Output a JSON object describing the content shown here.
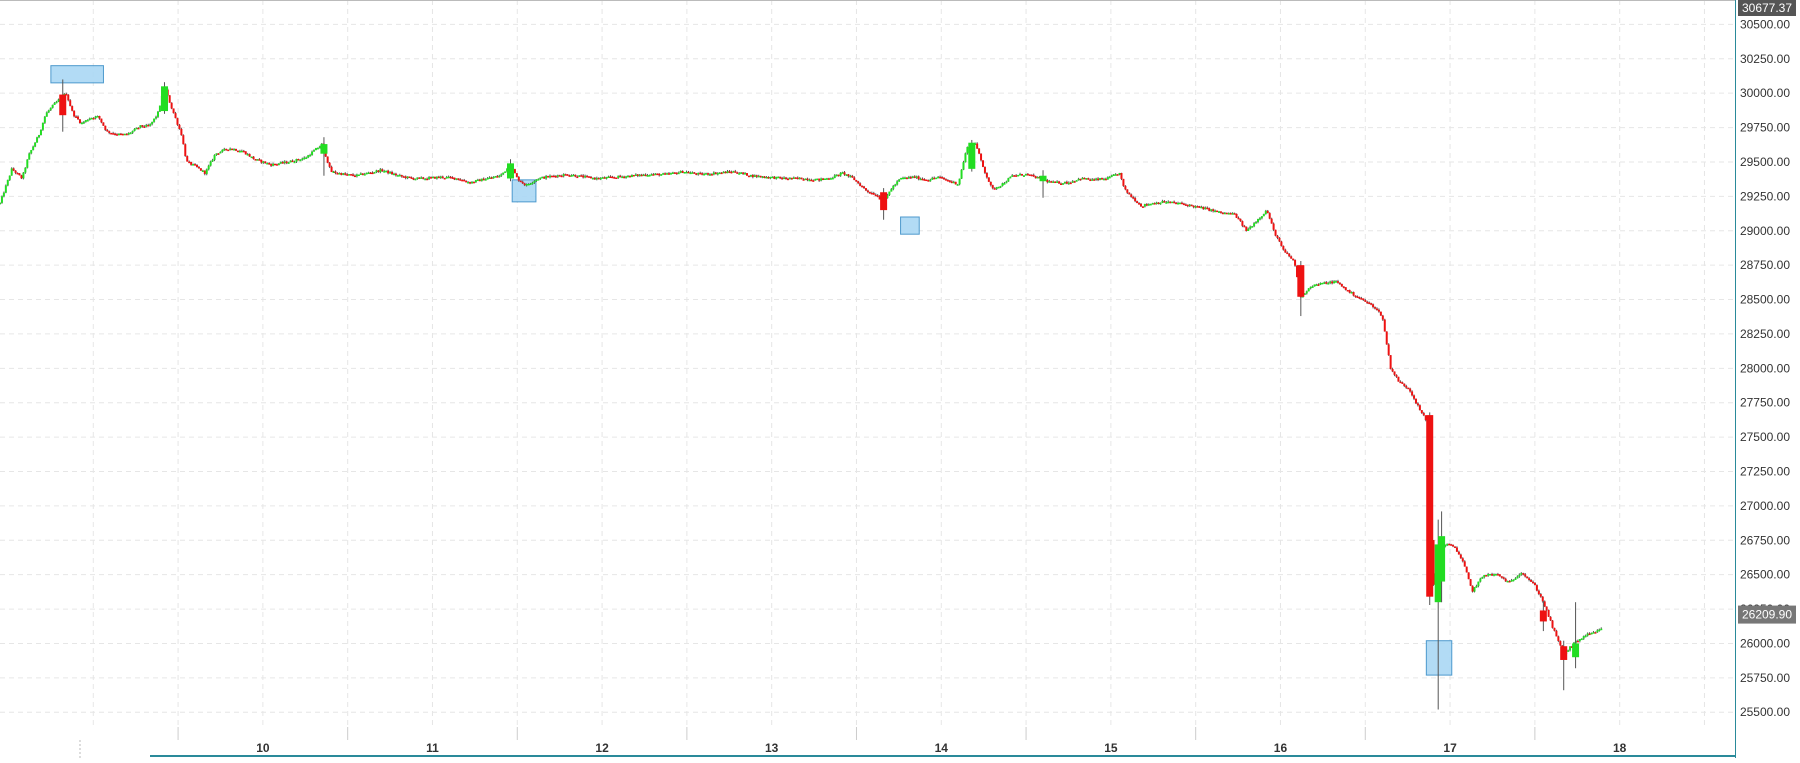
{
  "chart_data": {
    "type": "candlestick",
    "title": "",
    "xlabel": "",
    "ylabel": "",
    "ylim": [
      25400,
      30677.37
    ],
    "xlim": [
      8.45,
      18.68
    ],
    "grid": true,
    "y_ticks": [
      25500,
      25750,
      26000,
      26250,
      26500,
      26750,
      27000,
      27250,
      27500,
      27750,
      28000,
      28250,
      28500,
      28750,
      29000,
      29250,
      29500,
      29750,
      30000,
      30250,
      30500
    ],
    "y_tick_labels": [
      "25500.00",
      "25750.00",
      "26000.00",
      "26250.00",
      "26500.00",
      "26750.00",
      "27000.00",
      "27250.00",
      "27500.00",
      "27750.00",
      "28000.00",
      "28250.00",
      "28500.00",
      "28750.00",
      "29000.00",
      "29250.00",
      "29500.00",
      "29750.00",
      "30000.00",
      "30250.00",
      "30500.00"
    ],
    "x_ticks": [
      10,
      11,
      12,
      13,
      14,
      15,
      16,
      17,
      18
    ],
    "x_tick_labels": [
      "10",
      "11",
      "12",
      "13",
      "14",
      "15",
      "16",
      "17",
      "18"
    ],
    "top_price_label": "30677.37",
    "last_price_label": "26209.90",
    "last_price": 26209.9,
    "colors": {
      "up": "#22dd22",
      "down": "#ee1111",
      "wick": "#555555",
      "grid": "#e6e6e6",
      "marker_fill": "#aad8f5",
      "marker_stroke": "#3a8fc8",
      "axis_line": "#2a8a9a",
      "top_tag_bg": "#555555",
      "last_tag_bg": "#777777"
    },
    "path_points": [
      [
        8.45,
        29200
      ],
      [
        8.52,
        29450
      ],
      [
        8.58,
        29380
      ],
      [
        8.62,
        29550
      ],
      [
        8.68,
        29700
      ],
      [
        8.72,
        29850
      ],
      [
        8.77,
        29920
      ],
      [
        8.84,
        30000
      ],
      [
        8.88,
        29850
      ],
      [
        8.93,
        29780
      ],
      [
        8.98,
        29820
      ],
      [
        9.03,
        29830
      ],
      [
        9.08,
        29720
      ],
      [
        9.15,
        29700
      ],
      [
        9.2,
        29700
      ],
      [
        9.28,
        29760
      ],
      [
        9.33,
        29760
      ],
      [
        9.38,
        29850
      ],
      [
        9.42,
        30050
      ],
      [
        9.46,
        29900
      ],
      [
        9.52,
        29700
      ],
      [
        9.55,
        29500
      ],
      [
        9.6,
        29470
      ],
      [
        9.66,
        29420
      ],
      [
        9.72,
        29560
      ],
      [
        9.8,
        29600
      ],
      [
        9.88,
        29580
      ],
      [
        9.95,
        29520
      ],
      [
        10.05,
        29480
      ],
      [
        10.15,
        29500
      ],
      [
        10.25,
        29530
      ],
      [
        10.35,
        29630
      ],
      [
        10.4,
        29430
      ],
      [
        10.48,
        29410
      ],
      [
        10.55,
        29400
      ],
      [
        10.62,
        29420
      ],
      [
        10.7,
        29440
      ],
      [
        10.8,
        29400
      ],
      [
        10.88,
        29380
      ],
      [
        10.95,
        29380
      ],
      [
        11.05,
        29390
      ],
      [
        11.15,
        29380
      ],
      [
        11.22,
        29350
      ],
      [
        11.32,
        29380
      ],
      [
        11.4,
        29400
      ],
      [
        11.46,
        29480
      ],
      [
        11.5,
        29380
      ],
      [
        11.55,
        29330
      ],
      [
        11.62,
        29380
      ],
      [
        11.72,
        29400
      ],
      [
        11.8,
        29410
      ],
      [
        11.9,
        29390
      ],
      [
        11.97,
        29380
      ],
      [
        12.08,
        29390
      ],
      [
        12.18,
        29400
      ],
      [
        12.28,
        29410
      ],
      [
        12.38,
        29410
      ],
      [
        12.48,
        29430
      ],
      [
        12.58,
        29410
      ],
      [
        12.68,
        29420
      ],
      [
        12.78,
        29430
      ],
      [
        12.88,
        29400
      ],
      [
        12.98,
        29390
      ],
      [
        13.08,
        29380
      ],
      [
        13.18,
        29380
      ],
      [
        13.28,
        29370
      ],
      [
        13.36,
        29390
      ],
      [
        13.42,
        29420
      ],
      [
        13.48,
        29380
      ],
      [
        13.56,
        29290
      ],
      [
        13.62,
        29260
      ],
      [
        13.66,
        29200
      ],
      [
        13.7,
        29300
      ],
      [
        13.76,
        29380
      ],
      [
        13.84,
        29390
      ],
      [
        13.92,
        29370
      ],
      [
        13.98,
        29390
      ],
      [
        14.05,
        29360
      ],
      [
        14.1,
        29340
      ],
      [
        14.15,
        29600
      ],
      [
        14.2,
        29640
      ],
      [
        14.25,
        29450
      ],
      [
        14.3,
        29300
      ],
      [
        14.36,
        29340
      ],
      [
        14.42,
        29400
      ],
      [
        14.5,
        29410
      ],
      [
        14.58,
        29380
      ],
      [
        14.65,
        29350
      ],
      [
        14.75,
        29350
      ],
      [
        14.82,
        29380
      ],
      [
        14.9,
        29370
      ],
      [
        14.98,
        29380
      ],
      [
        15.05,
        29420
      ],
      [
        15.08,
        29300
      ],
      [
        15.12,
        29250
      ],
      [
        15.18,
        29180
      ],
      [
        15.24,
        29200
      ],
      [
        15.32,
        29210
      ],
      [
        15.4,
        29200
      ],
      [
        15.48,
        29180
      ],
      [
        15.56,
        29160
      ],
      [
        15.65,
        29130
      ],
      [
        15.73,
        29120
      ],
      [
        15.8,
        29000
      ],
      [
        15.88,
        29100
      ],
      [
        15.92,
        29150
      ],
      [
        15.96,
        29000
      ],
      [
        16.02,
        28850
      ],
      [
        16.08,
        28780
      ],
      [
        16.12,
        28520
      ],
      [
        16.18,
        28600
      ],
      [
        16.26,
        28620
      ],
      [
        16.33,
        28630
      ],
      [
        16.4,
        28560
      ],
      [
        16.48,
        28500
      ],
      [
        16.55,
        28450
      ],
      [
        16.6,
        28380
      ],
      [
        16.65,
        28000
      ],
      [
        16.7,
        27900
      ],
      [
        16.76,
        27850
      ],
      [
        16.82,
        27700
      ],
      [
        16.87,
        27600
      ],
      [
        16.9,
        26400
      ],
      [
        16.94,
        26700
      ],
      [
        16.98,
        26720
      ],
      [
        17.03,
        26700
      ],
      [
        17.08,
        26580
      ],
      [
        17.13,
        26380
      ],
      [
        17.2,
        26500
      ],
      [
        17.28,
        26500
      ],
      [
        17.35,
        26440
      ],
      [
        17.42,
        26520
      ],
      [
        17.5,
        26420
      ],
      [
        17.55,
        26300
      ],
      [
        17.61,
        26100
      ],
      [
        17.67,
        25920
      ],
      [
        17.73,
        26000
      ],
      [
        17.8,
        26060
      ],
      [
        17.86,
        26080
      ],
      [
        17.9,
        26120
      ]
    ],
    "highlighted_candles": [
      {
        "x": 8.82,
        "open": 29990,
        "high": 30100,
        "low": 29720,
        "close": 29840
      },
      {
        "x": 9.42,
        "open": 29870,
        "high": 30080,
        "low": 29850,
        "close": 30050
      },
      {
        "x": 10.36,
        "open": 29560,
        "high": 29680,
        "low": 29400,
        "close": 29630
      },
      {
        "x": 11.46,
        "open": 29380,
        "high": 29520,
        "low": 29360,
        "close": 29490
      },
      {
        "x": 13.66,
        "open": 29280,
        "high": 29310,
        "low": 29080,
        "close": 29150
      },
      {
        "x": 14.18,
        "open": 29450,
        "high": 29660,
        "low": 29430,
        "close": 29640
      },
      {
        "x": 14.6,
        "open": 29360,
        "high": 29440,
        "low": 29240,
        "close": 29400
      },
      {
        "x": 16.12,
        "open": 28750,
        "high": 28780,
        "low": 28380,
        "close": 28520
      },
      {
        "x": 16.88,
        "open": 27660,
        "high": 27680,
        "low": 26280,
        "close": 26340
      },
      {
        "x": 16.93,
        "open": 26300,
        "high": 26900,
        "low": 25520,
        "close": 26720
      },
      {
        "x": 16.95,
        "open": 26450,
        "high": 26960,
        "low": 26300,
        "close": 26780
      },
      {
        "x": 17.55,
        "open": 26240,
        "high": 26310,
        "low": 26090,
        "close": 26160
      },
      {
        "x": 17.67,
        "open": 25980,
        "high": 26020,
        "low": 25660,
        "close": 25880
      },
      {
        "x": 17.74,
        "open": 25900,
        "high": 26300,
        "low": 25820,
        "close": 26000
      }
    ],
    "markers": [
      {
        "x0": 8.75,
        "x1": 9.06,
        "y0": 30075,
        "y1": 30200
      },
      {
        "x0": 11.47,
        "x1": 11.61,
        "y0": 29210,
        "y1": 29370
      },
      {
        "x0": 13.76,
        "x1": 13.87,
        "y0": 28975,
        "y1": 29100
      },
      {
        "x0": 16.86,
        "x1": 17.01,
        "y0": 25770,
        "y1": 26020
      }
    ]
  }
}
